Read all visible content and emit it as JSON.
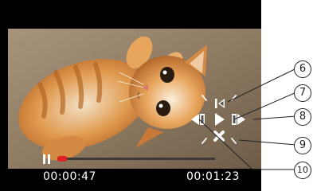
{
  "player": {
    "elapsed": "00:00:47",
    "total": "00:01:23",
    "progress_fraction": 0.035
  },
  "controls": {
    "prev": {
      "icon": "skip-previous-icon",
      "label": "6"
    },
    "play": {
      "icon": "play-icon",
      "label": "7"
    },
    "fast_forward": {
      "icon": "fast-forward-icon",
      "label": "8"
    },
    "stop": {
      "icon": "stop-icon",
      "label": "9"
    },
    "rewind": {
      "icon": "rewind-icon",
      "label": "10"
    }
  },
  "colors": {
    "progress": "#e02020",
    "control_ring": "#ffffff"
  }
}
